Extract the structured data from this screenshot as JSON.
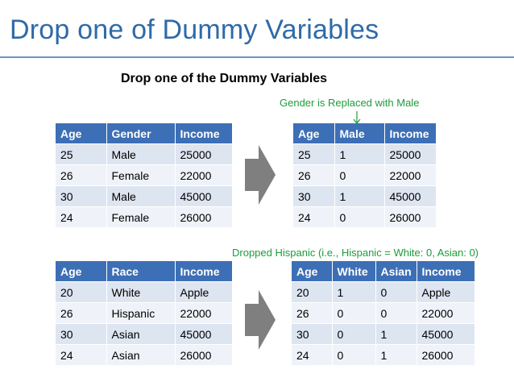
{
  "slide": {
    "title": "Drop one of Dummy Variables",
    "subtitle": "Drop one of the Dummy Variables",
    "note_gender": "Gender is Replaced with Male",
    "note_race": "Dropped Hispanic (i.e., Hispanic = White: 0, Asian: 0)"
  },
  "tables": {
    "gender_before": {
      "headers": [
        "Age",
        "Gender",
        "Income"
      ],
      "rows": [
        [
          "25",
          "Male",
          "25000"
        ],
        [
          "26",
          "Female",
          "22000"
        ],
        [
          "30",
          "Male",
          "45000"
        ],
        [
          "24",
          "Female",
          "26000"
        ]
      ]
    },
    "gender_after": {
      "headers": [
        "Age",
        "Male",
        "Income"
      ],
      "rows": [
        [
          "25",
          "1",
          "25000"
        ],
        [
          "26",
          "0",
          "22000"
        ],
        [
          "30",
          "1",
          "45000"
        ],
        [
          "24",
          "0",
          "26000"
        ]
      ]
    },
    "race_before": {
      "headers": [
        "Age",
        "Race",
        "Income"
      ],
      "rows": [
        [
          "20",
          "White",
          "Apple"
        ],
        [
          "26",
          "Hispanic",
          "22000"
        ],
        [
          "30",
          "Asian",
          "45000"
        ],
        [
          "24",
          "Asian",
          "26000"
        ]
      ]
    },
    "race_after": {
      "headers": [
        "Age",
        "White",
        "Asian",
        "Income"
      ],
      "rows": [
        [
          "20",
          "1",
          "0",
          "Apple"
        ],
        [
          "26",
          "0",
          "0",
          "22000"
        ],
        [
          "30",
          "0",
          "1",
          "45000"
        ],
        [
          "24",
          "0",
          "1",
          "26000"
        ]
      ]
    }
  },
  "colors": {
    "title": "#2f6aa8",
    "header_fill": "#3d6fb6",
    "row_odd": "#dde5f1",
    "row_even": "#eff3f9",
    "note": "#1d9c3a",
    "arrow": "#7f7f7f"
  },
  "icons": {
    "transform_arrow": "right-arrow-icon",
    "note_pointer": "down-arrow-icon"
  }
}
